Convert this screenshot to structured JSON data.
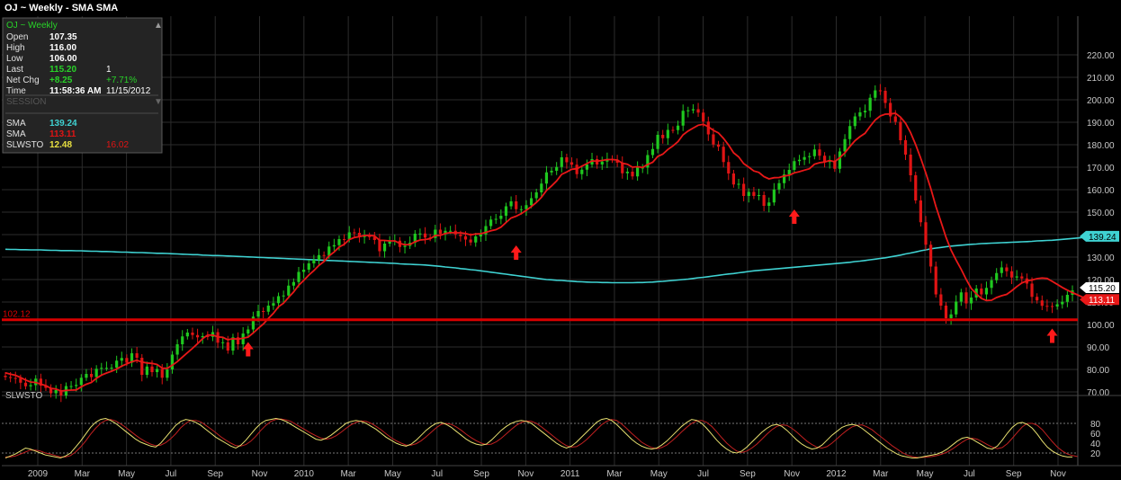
{
  "header": {
    "title": "OJ ~ Weekly  -  SMA SMA"
  },
  "info_panel": {
    "title": "OJ ~ Weekly",
    "rows": [
      {
        "label": "Open",
        "value": "107.35",
        "extra": ""
      },
      {
        "label": "High",
        "value": "116.00",
        "extra": ""
      },
      {
        "label": "Low",
        "value": "106.00",
        "extra": ""
      },
      {
        "label": "Last",
        "value": "115.20",
        "extra": "1"
      },
      {
        "label": "Net Chg",
        "value": "+8.25",
        "extra": "+7.71%"
      },
      {
        "label": "Time",
        "value": "11:58:36 AM",
        "extra": "11/15/2012"
      }
    ],
    "session_label": "SESSION",
    "indicators": [
      {
        "label": "SMA",
        "value": "139.24",
        "extra": ""
      },
      {
        "label": "SMA",
        "value": "113.11",
        "extra": ""
      },
      {
        "label": "SLWSTO",
        "value": "12.48",
        "extra": "16.02"
      }
    ]
  },
  "colors": {
    "up": "#1fc81f",
    "down": "#e01414",
    "sma_long": "#3fd2d2",
    "sma_short": "#e81818",
    "support": "#d80000",
    "stoch_k": "#e8e070",
    "stoch_d": "#c02020",
    "grid": "#2c2c2c",
    "info_green": "#28d228",
    "info_cyan": "#3fd2d2",
    "info_red": "#e01414",
    "info_yellow": "#e8e040"
  },
  "chart_data": {
    "type": "candlestick",
    "title": "OJ ~ Weekly  -  SMA SMA",
    "price_axis": {
      "ticks": [
        70,
        80,
        90,
        100,
        110,
        120,
        130,
        140,
        150,
        160,
        170,
        180,
        190,
        200,
        210,
        220
      ],
      "ylim": [
        62,
        228
      ]
    },
    "x_labels": [
      "2009",
      "Mar",
      "May",
      "Jul",
      "Sep",
      "Nov",
      "2010",
      "Mar",
      "May",
      "Jul",
      "Sep",
      "Nov",
      "2011",
      "Mar",
      "May",
      "Jul",
      "Sep",
      "Nov",
      "2012",
      "Mar",
      "May",
      "Jul",
      "Sep",
      "Nov"
    ],
    "support_line": {
      "value": 102.12,
      "label": "102.12"
    },
    "price_tags": [
      {
        "name": "SMA",
        "value": 139.24,
        "label": "139.24"
      },
      {
        "name": "Last",
        "value": 115.2,
        "label": "115.20"
      },
      {
        "name": "SMA",
        "value": 113.11,
        "label": "113.11"
      }
    ],
    "markers": [
      {
        "type": "up-arrow",
        "index": 48,
        "value": 89
      },
      {
        "type": "up-arrow",
        "index": 101,
        "value": 132
      },
      {
        "type": "up-arrow",
        "index": 156,
        "value": 148
      },
      {
        "type": "up-arrow",
        "index": 207,
        "value": 95
      }
    ],
    "close": [
      76.6,
      76.2,
      76.1,
      74.1,
      72.5,
      73.0,
      75.9,
      72.8,
      71.8,
      69.4,
      70.8,
      68.4,
      72.6,
      72.6,
      73.1,
      76.3,
      78.0,
      76.6,
      80.3,
      80.7,
      80.7,
      80.8,
      83.9,
      85.1,
      83.0,
      87.2,
      85.2,
      77.6,
      81.3,
      78.8,
      80.2,
      76.3,
      80.0,
      86.6,
      91.2,
      94.7,
      96.4,
      95.3,
      94.3,
      94.8,
      94.5,
      96.6,
      91.9,
      92.1,
      88.4,
      94.3,
      91.2,
      96.0,
      97.8,
      103.5,
      106.0,
      105.7,
      108.4,
      109.5,
      112.6,
      112.9,
      117.3,
      118.9,
      123.4,
      124.4,
      127.2,
      128.8,
      130.9,
      130.6,
      134.7,
      135.3,
      138.0,
      137.9,
      141.0,
      140.8,
      138.9,
      139.3,
      139.0,
      137.6,
      132.6,
      136.0,
      137.1,
      137.3,
      134.5,
      135.0,
      136.4,
      140.4,
      140.5,
      138.7,
      138.5,
      142.2,
      140.3,
      141.7,
      141.7,
      140.1,
      139.3,
      137.8,
      136.5,
      139.2,
      140.1,
      143.8,
      146.7,
      147.0,
      148.4,
      152.6,
      154.8,
      151.3,
      151.3,
      153.1,
      156.2,
      158.8,
      162.7,
      167.7,
      168.4,
      170.1,
      174.4,
      172.2,
      171.1,
      166.9,
      168.9,
      171.2,
      173.6,
      171.2,
      172.5,
      173.7,
      173.3,
      172.0,
      167.3,
      168.0,
      165.9,
      169.8,
      169.8,
      175.4,
      178.1,
      184.4,
      182.9,
      186.6,
      186.5,
      188.5,
      195.1,
      195.3,
      195.8,
      194.3,
      190.3,
      184.6,
      180.1,
      179.1,
      172.3,
      167.2,
      162.3,
      162.6,
      157.2,
      159.0,
      157.2,
      157.6,
      152.8,
      154.3,
      160.1,
      162.9,
      166.8,
      168.8,
      172.7,
      173.3,
      174.5,
      174.9,
      177.9,
      175.1,
      172.3,
      172.9,
      169.3,
      177.0,
      182.5,
      188.3,
      192.6,
      194.4,
      195.1,
      200.9,
      204.2,
      204.0,
      198.6,
      192.6,
      190.2,
      182.0,
      175.6,
      166.4,
      155.2,
      145.5,
      135.5,
      125.8,
      113.4,
      108.4,
      102.8,
      104.5,
      110.2,
      114.3,
      109.4,
      112.0,
      116.0,
      113.4,
      116.3,
      119.7,
      122.9,
      125.4,
      123.7,
      120.9,
      121.4,
      120.5,
      118.2,
      112.3,
      110.7,
      108.3,
      108.2,
      108.0,
      109.0,
      110.1,
      113.2,
      115.2
    ],
    "sma_short": [
      78.5,
      77.9,
      77.4,
      76.4,
      75.3,
      74.4,
      74.2,
      73.5,
      72.8,
      71.6,
      71.3,
      70.4,
      70.7,
      70.8,
      70.9,
      72.3,
      73.4,
      74.2,
      76.1,
      77.5,
      78.4,
      79.2,
      80.2,
      81.5,
      82.5,
      83.4,
      84.1,
      83.3,
      82.9,
      82.7,
      82.2,
      80.6,
      80.5,
      81.9,
      83.5,
      85.5,
      87.5,
      89.4,
      91.5,
      93.7,
      95.3,
      95.3,
      94.5,
      94.3,
      93.2,
      93.7,
      93.5,
      93.9,
      94.4,
      96.2,
      98.3,
      100.2,
      102.7,
      105.0,
      107.9,
      109.5,
      112.1,
      114.5,
      117.5,
      119.6,
      122.0,
      124.0,
      126.3,
      128.0,
      130.5,
      132.3,
      134.5,
      135.7,
      137.8,
      138.7,
      139.1,
      139.6,
      139.7,
      139.4,
      137.5,
      137.4,
      137.2,
      137.2,
      136.1,
      135.5,
      135.6,
      136.8,
      137.6,
      137.8,
      138.2,
      139.6,
      139.7,
      140.5,
      140.9,
      140.8,
      140.8,
      140.5,
      139.9,
      140.3,
      140.4,
      141.0,
      141.7,
      142.2,
      143.3,
      145.4,
      147.4,
      148.2,
      149.3,
      150.8,
      152.5,
      154.3,
      156.6,
      159.6,
      161.7,
      163.9,
      166.8,
      167.9,
      169.1,
      169.3,
      170.5,
      171.6,
      172.8,
      172.7,
      173.0,
      173.4,
      173.4,
      173.2,
      171.8,
      171.3,
      170.0,
      170.2,
      169.9,
      171.2,
      172.2,
      174.8,
      175.8,
      177.9,
      179.5,
      181.4,
      184.4,
      186.1,
      187.4,
      188.7,
      189.1,
      188.0,
      186.4,
      185.3,
      182.8,
      179.9,
      176.4,
      174.6,
      171.6,
      170.0,
      168.3,
      167.7,
      165.8,
      164.8,
      165.3,
      165.4,
      166.1,
      166.4,
      167.5,
      168.0,
      168.7,
      169.3,
      171.3,
      172.0,
      172.3,
      173.0,
      172.4,
      174.2,
      176.4,
      179.2,
      181.8,
      183.6,
      185.1,
      188.2,
      191.0,
      192.8,
      193.6,
      193.7,
      194.0,
      192.3,
      189.6,
      185.4,
      180.0,
      174.0,
      167.5,
      160.5,
      152.6,
      145.7,
      138.8,
      133.1,
      128.7,
      124.6,
      120.0,
      116.0,
      113.7,
      111.6,
      110.7,
      110.8,
      112.0,
      112.8,
      113.4,
      115.0,
      116.9,
      118.5,
      119.4,
      119.8,
      120.4,
      120.7,
      120.5,
      119.2,
      117.9,
      116.5,
      115.3,
      114.2,
      113.2,
      112.2,
      111.4,
      113.1
    ],
    "sma_long": [
      133.5,
      133.4,
      133.4,
      133.3,
      133.3,
      133.2,
      133.2,
      133.2,
      133.1,
      133.0,
      133.0,
      132.9,
      132.9,
      132.9,
      132.8,
      132.8,
      132.7,
      132.6,
      132.6,
      132.5,
      132.5,
      132.4,
      132.3,
      132.2,
      132.2,
      132.1,
      132.0,
      132.0,
      131.9,
      131.8,
      131.7,
      131.7,
      131.6,
      131.5,
      131.4,
      131.3,
      131.2,
      131.1,
      131.1,
      130.9,
      130.8,
      130.7,
      130.7,
      130.6,
      130.5,
      130.4,
      130.3,
      130.2,
      130.1,
      130.0,
      129.9,
      129.8,
      129.7,
      129.6,
      129.5,
      129.4,
      129.3,
      129.2,
      129.1,
      129.0,
      128.9,
      128.8,
      128.7,
      128.6,
      128.5,
      128.4,
      128.3,
      128.2,
      128.1,
      128.0,
      127.9,
      127.8,
      127.7,
      127.6,
      127.5,
      127.4,
      127.3,
      127.2,
      127.0,
      126.9,
      126.8,
      126.7,
      126.6,
      126.5,
      126.3,
      126.1,
      125.9,
      125.6,
      125.4,
      125.2,
      124.9,
      124.7,
      124.4,
      124.2,
      123.9,
      123.6,
      123.3,
      123.0,
      122.7,
      122.4,
      122.1,
      121.8,
      121.5,
      121.2,
      120.9,
      120.6,
      120.3,
      120.0,
      119.9,
      119.7,
      119.6,
      119.4,
      119.3,
      119.1,
      119.0,
      118.9,
      118.8,
      118.8,
      118.7,
      118.7,
      118.6,
      118.6,
      118.6,
      118.6,
      118.6,
      118.7,
      118.7,
      118.8,
      118.9,
      119.1,
      119.2,
      119.4,
      119.6,
      119.8,
      120.0,
      120.2,
      120.5,
      120.8,
      121.0,
      121.3,
      121.6,
      121.9,
      122.2,
      122.5,
      122.7,
      123.0,
      123.3,
      123.6,
      123.9,
      124.1,
      124.3,
      124.5,
      124.7,
      124.9,
      125.1,
      125.3,
      125.5,
      125.7,
      125.9,
      126.1,
      126.3,
      126.5,
      126.7,
      126.9,
      127.1,
      127.3,
      127.5,
      127.7,
      128.0,
      128.2,
      128.5,
      128.8,
      129.1,
      129.4,
      129.7,
      130.1,
      130.5,
      130.9,
      131.4,
      131.8,
      132.3,
      132.8,
      133.2,
      133.7,
      134.0,
      134.3,
      134.6,
      134.9,
      135.1,
      135.3,
      135.5,
      135.7,
      135.8,
      136.0,
      136.1,
      136.2,
      136.3,
      136.4,
      136.5,
      136.6,
      136.7,
      136.8,
      136.9,
      137.0,
      137.2,
      137.3,
      137.4,
      137.5,
      137.7,
      137.9,
      138.1,
      138.3,
      138.5,
      138.7,
      139.0,
      139.2
    ],
    "stochastic": {
      "name": "SLWSTO",
      "yticks": [
        20,
        40,
        60,
        80
      ],
      "levels": [
        20,
        80
      ],
      "k": [
        10,
        14,
        18,
        24,
        30,
        28,
        24,
        20,
        16,
        14,
        12,
        10,
        14,
        20,
        32,
        44,
        58,
        72,
        82,
        88,
        90,
        86,
        80,
        72,
        64,
        56,
        48,
        42,
        38,
        34,
        32,
        40,
        52,
        64,
        76,
        84,
        88,
        86,
        82,
        76,
        68,
        60,
        52,
        46,
        40,
        34,
        30,
        36,
        46,
        58,
        70,
        80,
        86,
        88,
        90,
        88,
        84,
        78,
        72,
        66,
        60,
        54,
        48,
        46,
        50,
        56,
        64,
        72,
        80,
        84,
        86,
        84,
        80,
        74,
        68,
        60,
        52,
        46,
        40,
        36,
        34,
        38,
        46,
        56,
        66,
        74,
        80,
        82,
        78,
        72,
        64,
        56,
        48,
        42,
        38,
        36,
        38,
        46,
        56,
        66,
        74,
        80,
        84,
        86,
        84,
        80,
        72,
        64,
        56,
        48,
        40,
        34,
        30,
        34,
        42,
        52,
        62,
        72,
        82,
        88,
        90,
        86,
        78,
        68,
        58,
        48,
        40,
        34,
        30,
        28,
        30,
        36,
        44,
        54,
        64,
        74,
        82,
        88,
        86,
        80,
        70,
        58,
        46,
        36,
        28,
        22,
        20,
        24,
        32,
        42,
        52,
        62,
        70,
        76,
        78,
        74,
        66,
        56,
        46,
        38,
        32,
        28,
        30,
        36,
        46,
        56,
        64,
        72,
        76,
        78,
        76,
        70,
        62,
        54,
        46,
        38,
        30,
        24,
        18,
        14,
        12,
        10,
        10,
        12,
        14,
        16,
        18,
        22,
        28,
        36,
        44,
        50,
        52,
        48,
        42,
        36,
        30,
        28,
        34,
        46,
        60,
        72,
        80,
        82,
        78,
        70,
        58,
        44,
        32,
        24,
        18,
        14,
        12,
        12
      ],
      "d": [
        12,
        12,
        14,
        18,
        22,
        26,
        26,
        24,
        20,
        18,
        15,
        12,
        12,
        15,
        22,
        32,
        44,
        58,
        70,
        80,
        86,
        88,
        85,
        79,
        72,
        64,
        56,
        49,
        43,
        38,
        35,
        36,
        41,
        49,
        59,
        71,
        80,
        86,
        86,
        83,
        76,
        69,
        61,
        53,
        46,
        40,
        35,
        34,
        37,
        44,
        54,
        66,
        76,
        84,
        88,
        89,
        87,
        84,
        78,
        72,
        66,
        60,
        55,
        50,
        48,
        50,
        55,
        62,
        70,
        77,
        82,
        85,
        84,
        80,
        74,
        67,
        59,
        51,
        45,
        40,
        36,
        36,
        39,
        45,
        53,
        62,
        71,
        78,
        80,
        78,
        73,
        66,
        58,
        51,
        45,
        40,
        37,
        38,
        43,
        50,
        59,
        68,
        76,
        82,
        85,
        84,
        80,
        73,
        65,
        57,
        49,
        41,
        35,
        32,
        33,
        39,
        47,
        57,
        67,
        77,
        84,
        88,
        86,
        79,
        70,
        60,
        51,
        42,
        36,
        31,
        29,
        31,
        36,
        44,
        53,
        63,
        72,
        80,
        85,
        86,
        82,
        74,
        63,
        51,
        40,
        31,
        24,
        21,
        24,
        30,
        38,
        48,
        58,
        67,
        74,
        77,
        76,
        70,
        62,
        53,
        44,
        37,
        32,
        30,
        33,
        40,
        49,
        58,
        66,
        73,
        76,
        77,
        73,
        67,
        59,
        51,
        43,
        35,
        28,
        21,
        16,
        13,
        11,
        11,
        12,
        13,
        15,
        18,
        22,
        28,
        35,
        42,
        48,
        50,
        48,
        43,
        37,
        32,
        29,
        31,
        39,
        50,
        62,
        73,
        80,
        80,
        76,
        67,
        55,
        43,
        32,
        24,
        18,
        15,
        13
      ]
    }
  }
}
